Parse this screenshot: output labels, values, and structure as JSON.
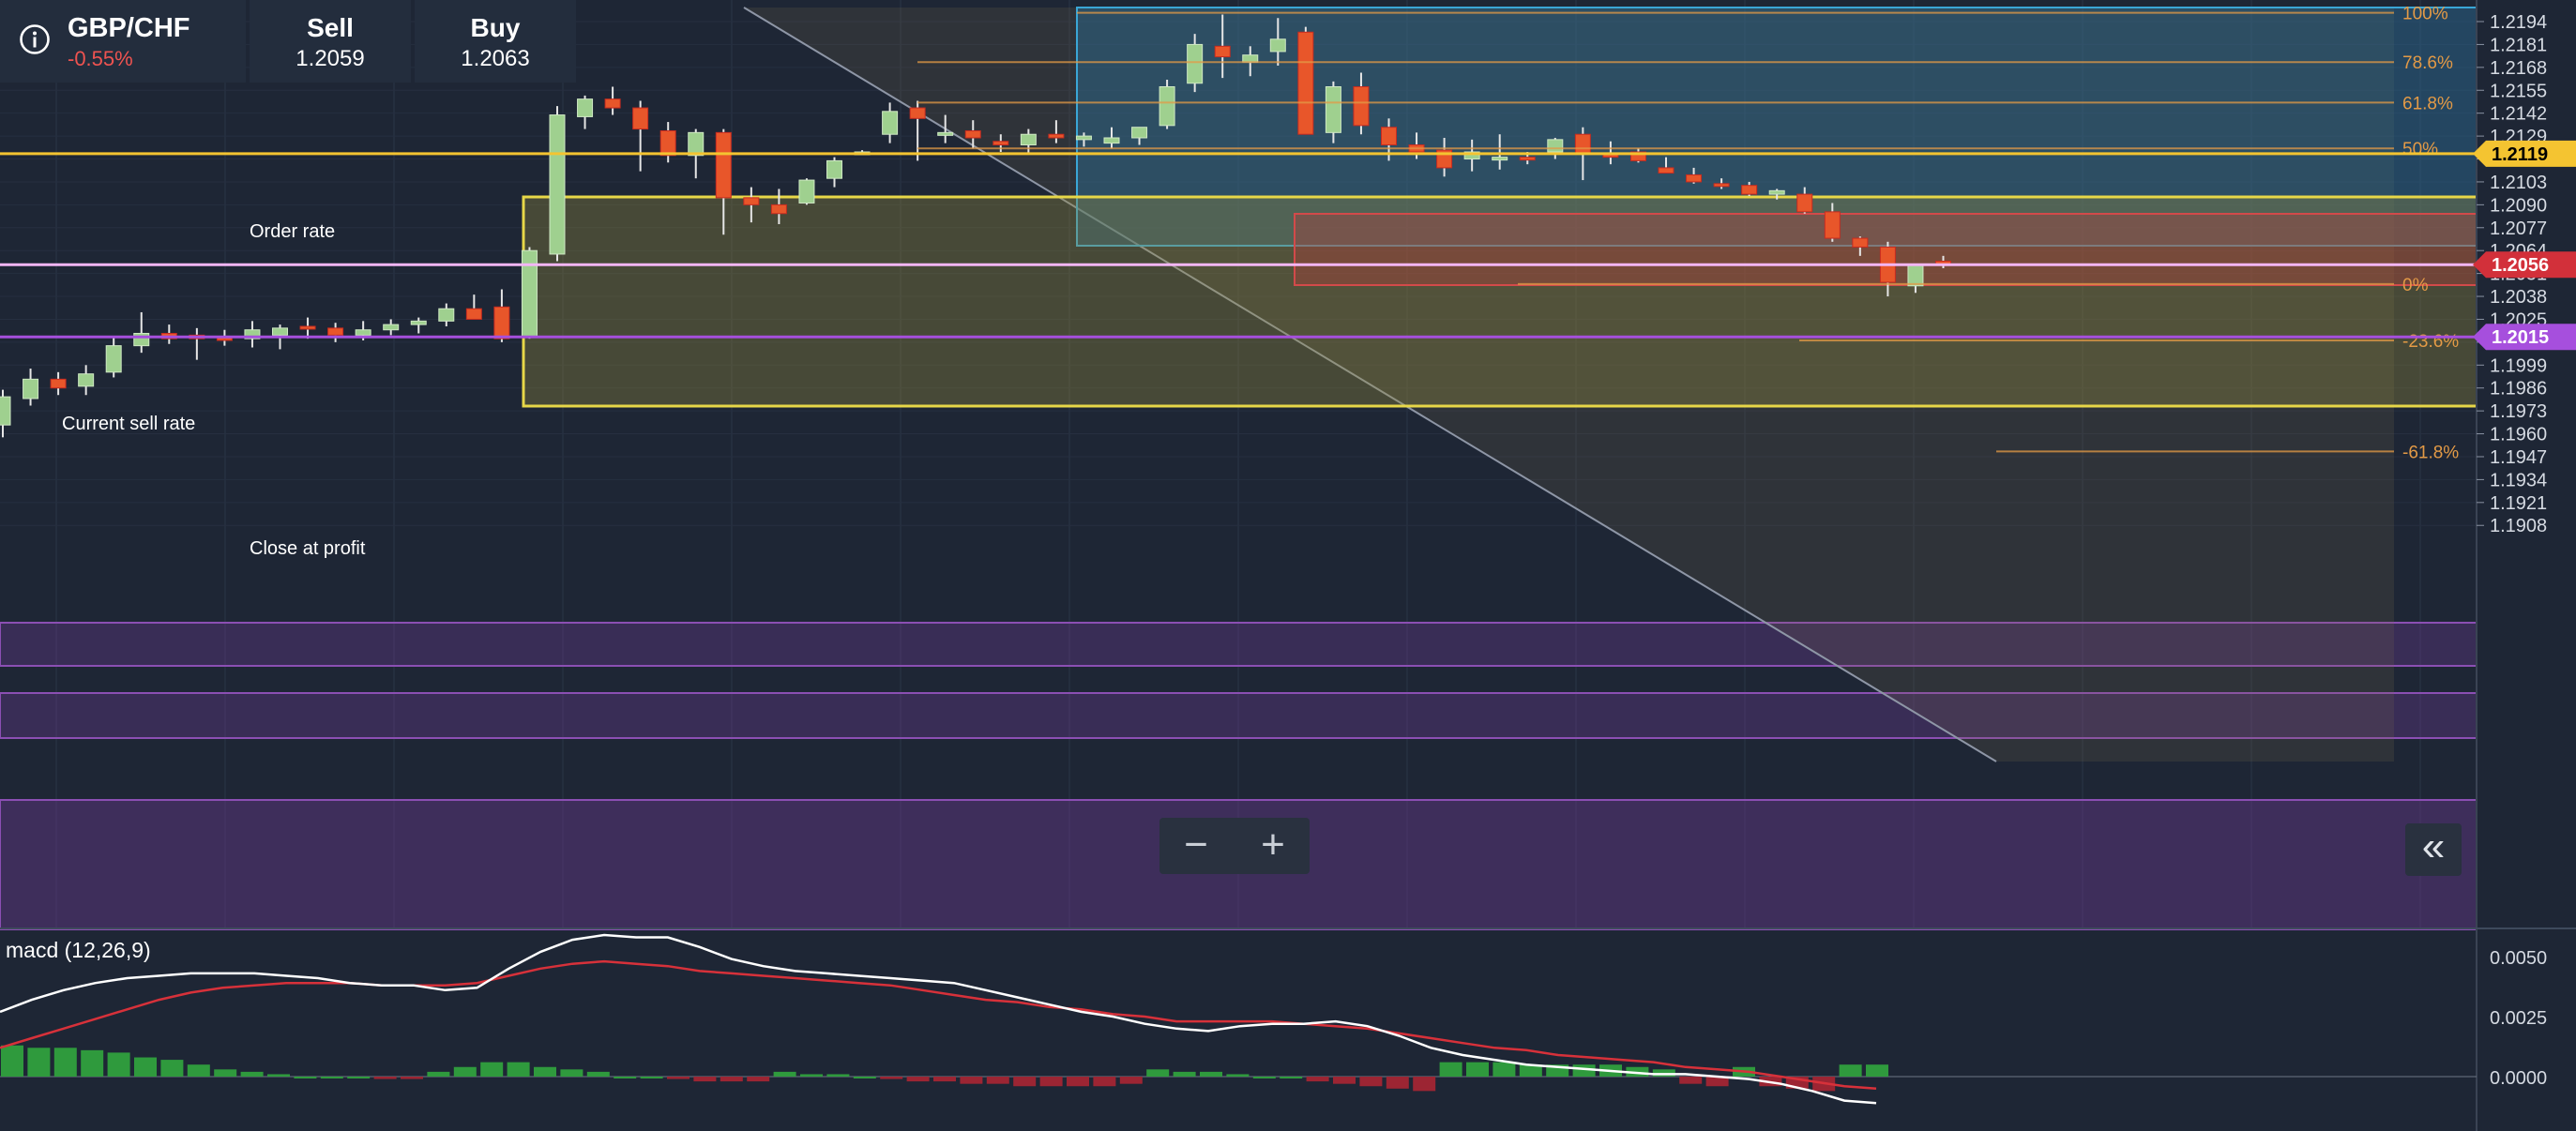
{
  "header": {
    "pair": "GBP/CHF",
    "change": "-0.55%",
    "sell_label": "Sell",
    "sell_value": "1.2059",
    "buy_label": "Buy",
    "buy_value": "1.2063"
  },
  "colors": {
    "background": "#1e2635",
    "bull": "#9fd08f",
    "bear": "#e8562a",
    "change_negative": "#ef5350",
    "order_rate": "#f4c431",
    "current_rate": "#f3b6f6",
    "close_at_profit": "#a64fdd",
    "fib": "#e39a46",
    "macd_line": "#ffffff",
    "signal_line": "#d7313a",
    "hist_pos": "#2f9a3d",
    "hist_neg": "#9c2533"
  },
  "chart_lines": {
    "order_rate": {
      "label": "Order rate",
      "value": 1.2119,
      "tag": "1.2119"
    },
    "current_sell_rate": {
      "label": "Current sell rate",
      "value": 1.2056,
      "tag": "1.2056"
    },
    "close_at_profit": {
      "label": "Close at profit",
      "value": 1.2015,
      "tag": "1.2015"
    }
  },
  "price_axis": {
    "ticks": [
      "1.2194",
      "1.2181",
      "1.2168",
      "1.2155",
      "1.2142",
      "1.2129",
      "1.2116",
      "1.2103",
      "1.2090",
      "1.2077",
      "1.2064",
      "1.2051",
      "1.2038",
      "1.2025",
      "1.2012",
      "1.1999",
      "1.1986",
      "1.1973",
      "1.1960",
      "1.1947",
      "1.1934",
      "1.1921",
      "1.1908"
    ]
  },
  "fibonacci": {
    "levels": [
      {
        "label": "100%",
        "price": 1.2199
      },
      {
        "label": "78.6%",
        "price": 1.2171
      },
      {
        "label": "61.8%",
        "price": 1.2148
      },
      {
        "label": "50%",
        "price": 1.2122
      },
      {
        "label": "0%",
        "price": 1.2045
      },
      {
        "label": "-23.6%",
        "price": 1.2013
      },
      {
        "label": "-61.8%",
        "price": 1.195
      }
    ]
  },
  "controls": {
    "zoom_out": "−",
    "zoom_in": "+",
    "collapse": "«"
  },
  "macd": {
    "label": "macd (12,26,9)",
    "ticks": [
      "0.0050",
      "0.0025",
      "0.0000"
    ]
  },
  "chart_data": {
    "type": "candlestick",
    "symbol": "GBP/CHF",
    "ylim": [
      1.1896,
      1.2202
    ],
    "candles": [
      [
        1.1965,
        1.1985,
        1.1958,
        1.1981
      ],
      [
        1.198,
        1.1997,
        1.1976,
        1.1991
      ],
      [
        1.1991,
        1.1995,
        1.1982,
        1.1986
      ],
      [
        1.1987,
        1.1999,
        1.1982,
        1.1994
      ],
      [
        1.1995,
        1.2015,
        1.1992,
        1.201
      ],
      [
        1.201,
        1.2029,
        1.2006,
        1.2017
      ],
      [
        1.2017,
        1.2022,
        1.2011,
        1.2014
      ],
      [
        1.2016,
        1.202,
        1.2002,
        1.2014
      ],
      [
        1.2015,
        1.2019,
        1.201,
        1.2013
      ],
      [
        1.2014,
        1.2024,
        1.2009,
        1.2019
      ],
      [
        1.2016,
        1.2022,
        1.2008,
        1.202
      ],
      [
        1.2021,
        1.2026,
        1.2014,
        1.202
      ],
      [
        1.202,
        1.2023,
        1.2012,
        1.2016
      ],
      [
        1.2016,
        1.2024,
        1.2013,
        1.2019
      ],
      [
        1.2019,
        1.2025,
        1.2016,
        1.2022
      ],
      [
        1.2022,
        1.2026,
        1.2017,
        1.2024
      ],
      [
        1.2024,
        1.2034,
        1.2021,
        1.2031
      ],
      [
        1.2031,
        1.2039,
        1.2027,
        1.2025
      ],
      [
        1.2032,
        1.2042,
        1.2012,
        1.2014
      ],
      [
        1.2015,
        1.2066,
        1.2014,
        1.2064
      ],
      [
        1.2062,
        1.2146,
        1.2058,
        1.2141
      ],
      [
        1.214,
        1.2152,
        1.2133,
        1.215
      ],
      [
        1.215,
        1.2157,
        1.2141,
        1.2145
      ],
      [
        1.2145,
        1.2149,
        1.2109,
        1.2133
      ],
      [
        1.2132,
        1.2137,
        1.2114,
        1.2118
      ],
      [
        1.2118,
        1.2133,
        1.2105,
        1.2131
      ],
      [
        1.2131,
        1.2133,
        1.2073,
        1.2094
      ],
      [
        1.2094,
        1.21,
        1.208,
        1.209
      ],
      [
        1.209,
        1.2099,
        1.2079,
        1.2085
      ],
      [
        1.2091,
        1.2105,
        1.209,
        1.2104
      ],
      [
        1.2105,
        1.2117,
        1.21,
        1.2115
      ],
      [
        1.2119,
        1.2121,
        1.2119,
        1.212
      ],
      [
        1.213,
        1.2148,
        1.2125,
        1.2143
      ],
      [
        1.2145,
        1.2149,
        1.2115,
        1.2139
      ],
      [
        1.2131,
        1.2141,
        1.2125,
        1.2131
      ],
      [
        1.2132,
        1.2138,
        1.2122,
        1.2128
      ],
      [
        1.2126,
        1.213,
        1.212,
        1.2124
      ],
      [
        1.2124,
        1.2133,
        1.2119,
        1.213
      ],
      [
        1.213,
        1.2138,
        1.2125,
        1.2128
      ],
      [
        1.2127,
        1.2131,
        1.2123,
        1.2129
      ],
      [
        1.2125,
        1.2134,
        1.2122,
        1.2128
      ],
      [
        1.2128,
        1.2133,
        1.2124,
        1.2134
      ],
      [
        1.2135,
        1.2161,
        1.2133,
        1.2157
      ],
      [
        1.2159,
        1.2187,
        1.2154,
        1.2181
      ],
      [
        1.218,
        1.2198,
        1.2162,
        1.2174
      ],
      [
        1.2171,
        1.218,
        1.2163,
        1.2175
      ],
      [
        1.2177,
        1.2196,
        1.2169,
        1.2184
      ],
      [
        1.2188,
        1.2191,
        1.2162,
        1.213
      ],
      [
        1.2131,
        1.216,
        1.2125,
        1.2157
      ],
      [
        1.2157,
        1.2165,
        1.213,
        1.2135
      ],
      [
        1.2134,
        1.2139,
        1.2115,
        1.2124
      ],
      [
        1.2124,
        1.2131,
        1.2116,
        1.212
      ],
      [
        1.2121,
        1.2128,
        1.2106,
        1.2111
      ],
      [
        1.2116,
        1.2127,
        1.2109,
        1.212
      ],
      [
        1.2116,
        1.213,
        1.211,
        1.2117
      ],
      [
        1.2117,
        1.212,
        1.2113,
        1.2116
      ],
      [
        1.212,
        1.2128,
        1.2116,
        1.2127
      ],
      [
        1.213,
        1.2134,
        1.2104,
        1.2119
      ],
      [
        1.2119,
        1.2126,
        1.2113,
        1.2117
      ],
      [
        1.212,
        1.2122,
        1.2114,
        1.2115
      ],
      [
        1.2111,
        1.2117,
        1.2108,
        1.2108
      ],
      [
        1.2107,
        1.2111,
        1.2102,
        1.2103
      ],
      [
        1.2102,
        1.2105,
        1.2099,
        1.2101
      ],
      [
        1.2101,
        1.2103,
        1.2095,
        1.2096
      ],
      [
        1.2096,
        1.2099,
        1.2093,
        1.2098
      ],
      [
        1.2096,
        1.21,
        1.2085,
        1.2086
      ],
      [
        1.2086,
        1.2091,
        1.2069,
        1.2071
      ],
      [
        1.2071,
        1.2072,
        1.2061,
        1.2066
      ],
      [
        1.2066,
        1.2069,
        1.2038,
        1.2046
      ],
      [
        1.2044,
        1.2055,
        1.204,
        1.2056
      ],
      [
        1.2058,
        1.2061,
        1.2054,
        1.2056
      ]
    ],
    "macd_line": [
      0.0027,
      0.0032,
      0.0036,
      0.0039,
      0.0041,
      0.0042,
      0.0043,
      0.0043,
      0.0043,
      0.0042,
      0.0041,
      0.0039,
      0.0038,
      0.0038,
      0.0036,
      0.0037,
      0.0045,
      0.0052,
      0.0057,
      0.0059,
      0.0058,
      0.0058,
      0.0054,
      0.0049,
      0.0046,
      0.0044,
      0.0043,
      0.0042,
      0.0041,
      0.004,
      0.0039,
      0.0036,
      0.0033,
      0.003,
      0.0027,
      0.0025,
      0.0022,
      0.002,
      0.0019,
      0.0021,
      0.0022,
      0.0022,
      0.0023,
      0.0021,
      0.0017,
      0.0012,
      0.0009,
      0.0007,
      0.0005,
      0.0004,
      0.0003,
      0.0002,
      0.0001,
      0.0001,
      0.0,
      -0.0001,
      -0.0003,
      -0.0006,
      -0.001,
      -0.0011
    ],
    "signal_line": [
      0.0012,
      0.0016,
      0.002,
      0.0024,
      0.0028,
      0.0032,
      0.0035,
      0.0037,
      0.0038,
      0.0039,
      0.0039,
      0.0039,
      0.0038,
      0.0038,
      0.0038,
      0.0039,
      0.0042,
      0.0045,
      0.0047,
      0.0048,
      0.0047,
      0.0046,
      0.0044,
      0.0043,
      0.0042,
      0.0041,
      0.004,
      0.0039,
      0.0038,
      0.0036,
      0.0034,
      0.0032,
      0.0031,
      0.0029,
      0.0028,
      0.0026,
      0.0025,
      0.0023,
      0.0023,
      0.0023,
      0.0023,
      0.0022,
      0.0021,
      0.002,
      0.0018,
      0.0016,
      0.0014,
      0.0012,
      0.0011,
      0.0009,
      0.0008,
      0.0007,
      0.0006,
      0.0004,
      0.0003,
      0.0002,
      0.0,
      -0.0002,
      -0.0004,
      -0.0005
    ],
    "histogram": [
      0.0013,
      0.0012,
      0.0012,
      0.0011,
      0.001,
      0.0008,
      0.0007,
      0.0005,
      0.0003,
      0.0002,
      0.0001,
      0.0,
      0.0,
      0.0,
      -0.0001,
      -0.0001,
      0.0002,
      0.0004,
      0.0006,
      0.0006,
      0.0004,
      0.0003,
      0.0002,
      0.0,
      0.0,
      -0.0001,
      -0.0002,
      -0.0002,
      -0.0002,
      0.0002,
      0.0001,
      0.0001,
      0.0,
      -0.0001,
      -0.0002,
      -0.0002,
      -0.0003,
      -0.0003,
      -0.0004,
      -0.0004,
      -0.0004,
      -0.0004,
      -0.0003,
      0.0003,
      0.0002,
      0.0002,
      0.0001,
      0.0,
      0.0,
      -0.0002,
      -0.0003,
      -0.0004,
      -0.0005,
      -0.0006,
      0.0006,
      0.0006,
      0.0006,
      0.0005,
      0.0005,
      0.0005,
      0.0005,
      0.0004,
      0.0003,
      -0.0003,
      -0.0004,
      0.0004,
      -0.0004,
      -0.0005,
      -0.0006,
      0.0005,
      0.0005
    ]
  }
}
